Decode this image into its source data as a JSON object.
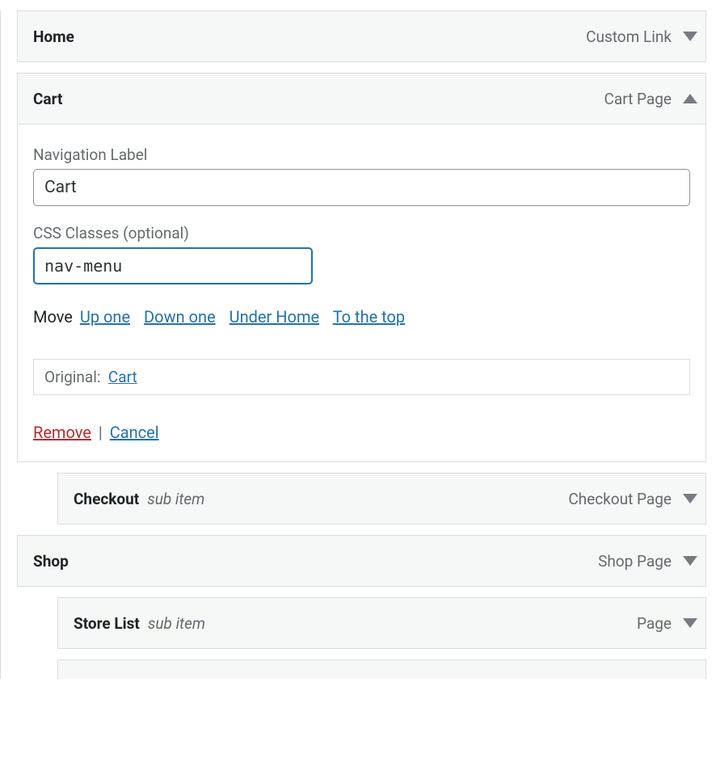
{
  "items": [
    {
      "title": "Home",
      "sub": "",
      "type": "Custom Link",
      "expanded": false,
      "indented": false
    },
    {
      "title": "Cart",
      "sub": "",
      "type": "Cart Page",
      "expanded": true,
      "indented": false
    },
    {
      "title": "Checkout",
      "sub": "sub item",
      "type": "Checkout Page",
      "expanded": false,
      "indented": true
    },
    {
      "title": "Shop",
      "sub": "",
      "type": "Shop Page",
      "expanded": false,
      "indented": false
    },
    {
      "title": "Store List",
      "sub": "sub item",
      "type": "Page",
      "expanded": false,
      "indented": true
    }
  ],
  "edit": {
    "nav_label_title": "Navigation Label",
    "nav_label_value": "Cart",
    "css_label_title": "CSS Classes (optional)",
    "css_value": "nav-menu",
    "move_label": "Move",
    "move_up": "Up one",
    "move_down": "Down one",
    "move_under": "Under Home",
    "move_top": "To the top",
    "original_label": "Original:",
    "original_link": "Cart",
    "remove": "Remove",
    "separator": "|",
    "cancel": "Cancel"
  }
}
